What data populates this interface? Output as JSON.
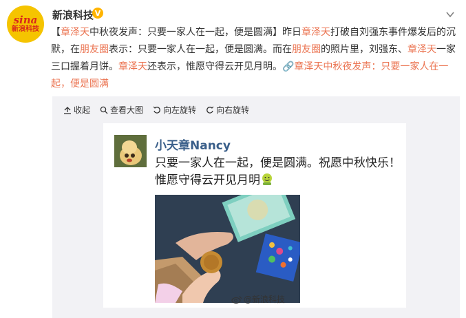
{
  "account": {
    "name": "新浪科技",
    "avatar_logo_top": "sina",
    "avatar_logo_bottom": "新浪科技",
    "verified_badge": "V",
    "menu_icon": "chevron-down-icon"
  },
  "post": {
    "segments": [
      {
        "text": "【",
        "style": "normal"
      },
      {
        "text": "章泽天",
        "style": "highlight"
      },
      {
        "text": "中秋夜发声：只要一家人在一起，便是圆满】昨日",
        "style": "normal"
      },
      {
        "text": "章泽天",
        "style": "highlight"
      },
      {
        "text": "打破自刘强东事件爆发后的沉默，在",
        "style": "normal"
      },
      {
        "text": "朋友圈",
        "style": "highlight"
      },
      {
        "text": "表示：只要一家人在一起，便是圆满。而在",
        "style": "normal"
      },
      {
        "text": "朋友圈",
        "style": "highlight"
      },
      {
        "text": "的照片里，刘强东、",
        "style": "normal"
      },
      {
        "text": "章泽天",
        "style": "highlight"
      },
      {
        "text": "一家三口握着月饼。",
        "style": "normal"
      },
      {
        "text": "章泽天",
        "style": "highlight"
      },
      {
        "text": "还表示，惟愿守得云开见月明。",
        "style": "normal"
      },
      {
        "text": "🔗章泽天中秋夜发声：只要一家人在一起，便是圆满",
        "style": "link"
      }
    ]
  },
  "toolbar": {
    "items": [
      {
        "label": "收起",
        "icon": "collapse-icon",
        "name": "collapse-button"
      },
      {
        "label": "查看大图",
        "icon": "magnifier-icon",
        "name": "view-large-button"
      },
      {
        "label": "向左旋转",
        "icon": "rotate-left-icon",
        "name": "rotate-left-button"
      },
      {
        "label": "向右旋转",
        "icon": "rotate-right-icon",
        "name": "rotate-right-button"
      }
    ]
  },
  "card": {
    "name": "小天章Nancy",
    "text": "只要一家人在一起，便是圆满。祝愿中秋快乐！惟愿守得云开见月明",
    "emoji": "smiling-face-emoji",
    "watermark": "@新浪科技",
    "colors": {
      "name": "#3a5f8a",
      "highlight": "#eb7350",
      "panel": "#f2f2f5"
    }
  }
}
